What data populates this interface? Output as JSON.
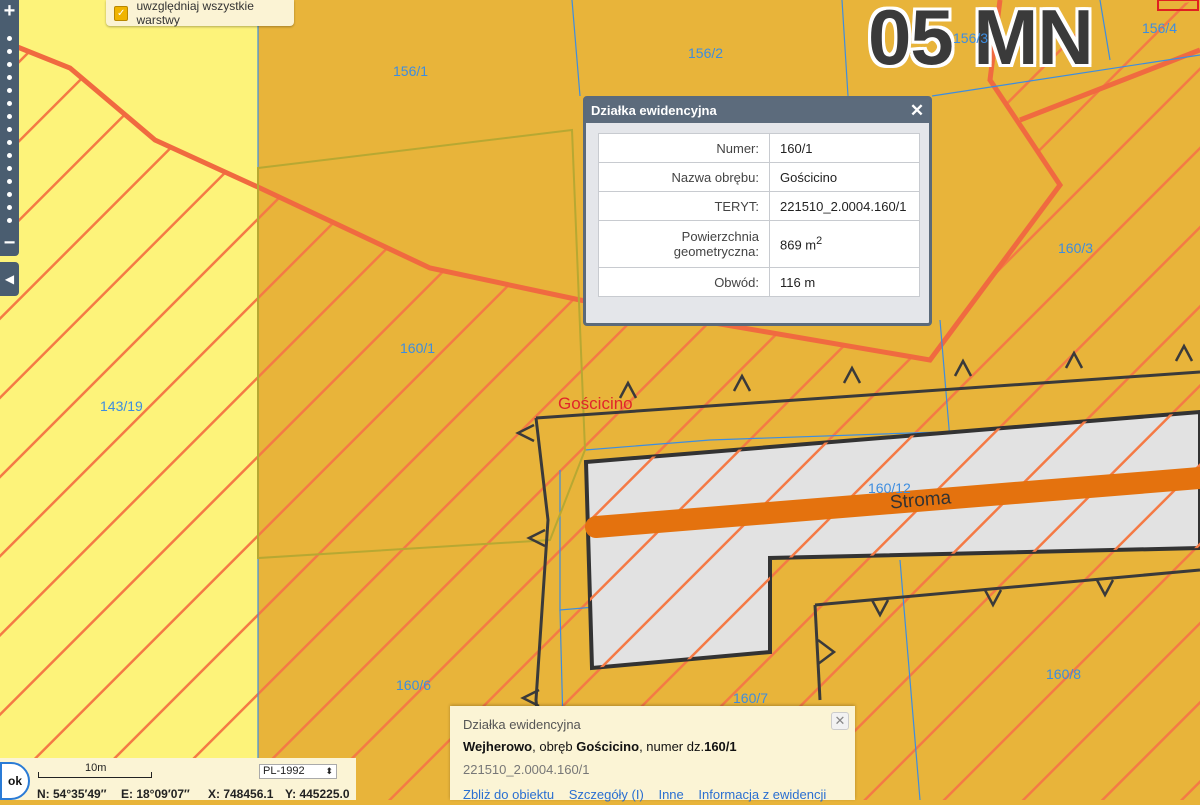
{
  "map": {
    "zone_label": "05 MN",
    "parcel_labels": [
      "156/1",
      "156/2",
      "156/3",
      "156/4",
      "160/3",
      "160/1",
      "143/19",
      "160/12",
      "160/6",
      "160/7",
      "160/8"
    ],
    "place_label": "Gościcino",
    "street_label": "Stroma",
    "colors": {
      "zone_yellow": "#fdf37a",
      "parcel_fill": "#e8b43a",
      "hatch": "#f47a45",
      "road_fill": "#e2e2e2",
      "road_centerline": "#e4720e",
      "parcel_border": "#3d8de0"
    }
  },
  "layer_toggle": {
    "label": "uwzględniaj wszystkie warstwy",
    "checked": true
  },
  "zoom": {
    "plus": "+",
    "minus": "−",
    "panel_toggle_icon": "chevron-left-icon"
  },
  "popup": {
    "title": "Działka ewidencyjna",
    "rows": [
      {
        "key": "Numer:",
        "value": "160/1"
      },
      {
        "key": "Nazwa obrębu:",
        "value": "Gościcino"
      },
      {
        "key": "TERYT:",
        "value": "221510_2.0004.160/1"
      },
      {
        "key": "Powierzchnia geometryczna:",
        "value": "869 m",
        "sup": "2"
      },
      {
        "key": "Obwód:",
        "value": "116 m"
      }
    ]
  },
  "bottom_info": {
    "title": "Działka ewidencyjna",
    "main": {
      "town": "Wejherowo",
      "sep1": ", obręb ",
      "district": "Gościcino",
      "sep2": ", numer dz.",
      "number": "160/1"
    },
    "teryt": "221510_2.0004.160/1",
    "links": [
      "Zbliż do obiektu",
      "Szczegóły (I)",
      "Inne",
      "Informacja z ewidencji"
    ]
  },
  "status": {
    "ok_label": "ok",
    "scale_label": "10m",
    "crs": "PL-1992",
    "lat": "N: 54°35′49″",
    "lon": "E: 18°09′07″",
    "x": "X: 748456.1",
    "y": "Y: 445225.0"
  }
}
